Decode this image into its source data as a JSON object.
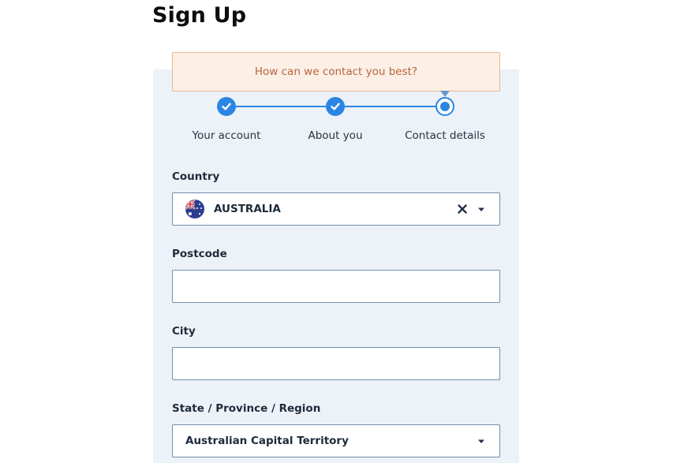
{
  "page": {
    "title": "Sign Up"
  },
  "tooltip": {
    "text": "How can we contact you best?"
  },
  "stepper": {
    "steps": [
      {
        "label": "Your account",
        "state": "done"
      },
      {
        "label": "About you",
        "state": "done"
      },
      {
        "label": "Contact details",
        "state": "current"
      }
    ]
  },
  "form": {
    "country": {
      "label": "Country",
      "value": "AUSTRALIA",
      "flag_icon": "australia-flag-icon"
    },
    "postcode": {
      "label": "Postcode",
      "value": ""
    },
    "city": {
      "label": "City",
      "value": ""
    },
    "state": {
      "label": "State / Province / Region",
      "value": "Australian Capital Territory"
    }
  },
  "colors": {
    "accent": "#2b86e3",
    "panel_bg": "#edf2f8",
    "tooltip_bg": "#fcefe6",
    "tooltip_text": "#b9643a",
    "tooltip_border": "#e9b891",
    "field_border": "#6f8eb0"
  }
}
